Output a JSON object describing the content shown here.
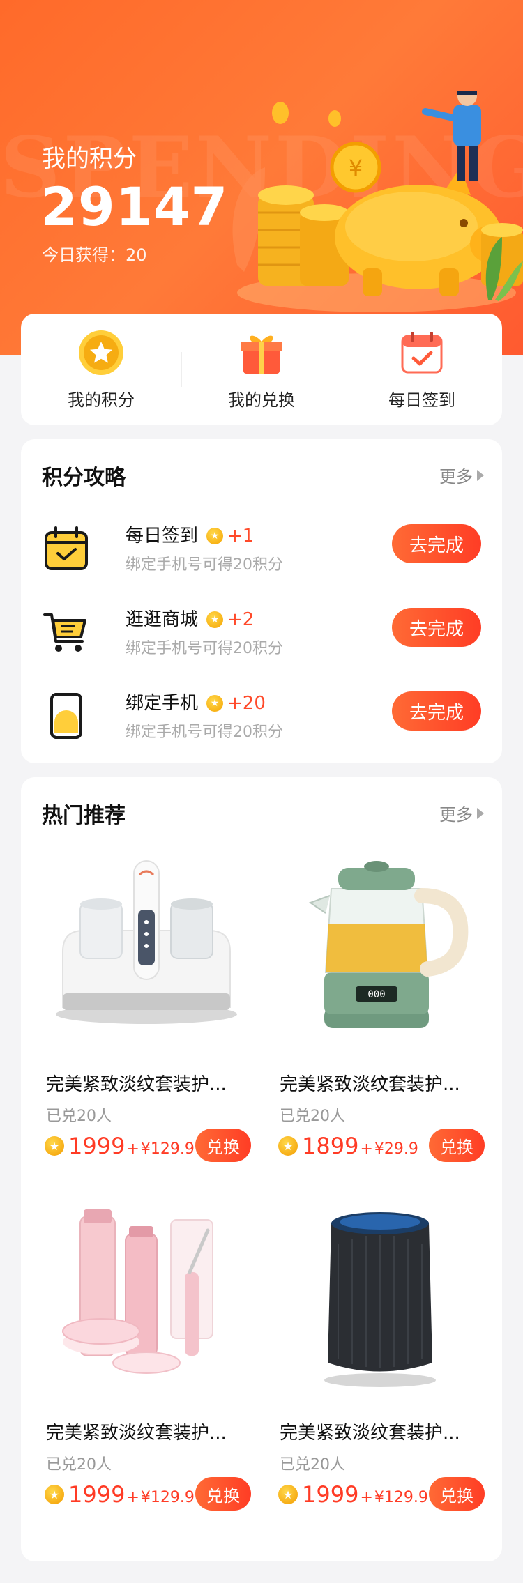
{
  "hero": {
    "watermark": "SPENDING",
    "title": "我的积分",
    "points": "29147",
    "today_label": "今日获得：20"
  },
  "quick_nav": [
    {
      "label": "我的积分",
      "icon": "star-coin-icon"
    },
    {
      "label": "我的兑换",
      "icon": "gift-box-icon"
    },
    {
      "label": "每日签到",
      "icon": "calendar-check-icon"
    }
  ],
  "strategy": {
    "title": "积分攻略",
    "more": "更多",
    "tasks": [
      {
        "name": "每日签到",
        "plus": "+1",
        "desc": "绑定手机号可得20积分",
        "button": "去完成",
        "icon": "calendar-check-icon"
      },
      {
        "name": "逛逛商城",
        "plus": "+2",
        "desc": "绑定手机号可得20积分",
        "button": "去完成",
        "icon": "shopping-cart-icon"
      },
      {
        "name": "绑定手机",
        "plus": "+20",
        "desc": "绑定手机号可得20积分",
        "button": "去完成",
        "icon": "phone-icon"
      }
    ]
  },
  "hot": {
    "title": "热门推荐",
    "more": "更多",
    "products": [
      {
        "name": "完美紧致淡纹套装护...",
        "sold": "已兑20人",
        "points": "1999",
        "plus": "+",
        "cash": "¥129.9",
        "button": "兑换",
        "image": "mite-remover-device"
      },
      {
        "name": "完美紧致淡纹套装护...",
        "sold": "已兑20人",
        "points": "1899",
        "plus": "+",
        "cash": "¥29.9",
        "button": "兑换",
        "image": "glass-tea-kettle"
      },
      {
        "name": "完美紧致淡纹套装护...",
        "sold": "已兑20人",
        "points": "1999",
        "plus": "+",
        "cash": "¥129.9",
        "button": "兑换",
        "image": "skincare-set"
      },
      {
        "name": "完美紧致淡纹套装护...",
        "sold": "已兑20人",
        "points": "1999",
        "plus": "+",
        "cash": "¥129.9",
        "button": "兑换",
        "image": "smart-speaker"
      }
    ]
  },
  "colors": {
    "accent": "#ff4a2a",
    "hero_gradient_start": "#ff6a2a",
    "coin": "#f5a300"
  }
}
